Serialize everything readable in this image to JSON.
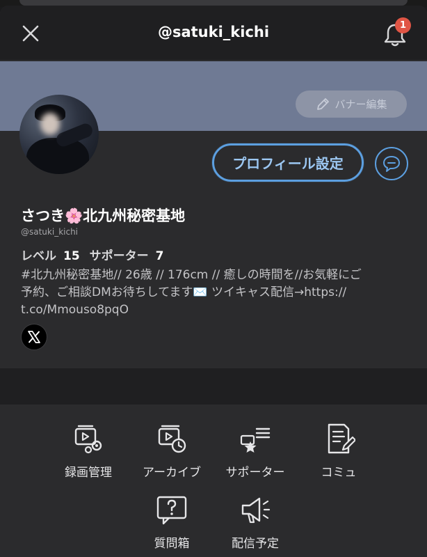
{
  "header": {
    "title": "@satuki_kichi",
    "notification_count": "1",
    "close_icon": "close-icon",
    "bell_icon": "bell-icon"
  },
  "banner": {
    "edit_label": "バナー編集",
    "edit_icon": "pencil-icon"
  },
  "profile": {
    "settings_label": "プロフィール設定",
    "display_name": "さつき🌸北九州秘密基地",
    "handle": "@satuki_kichi",
    "level_label": "レベル",
    "level_value": "15",
    "supporter_label": "サポーター",
    "supporter_value": "7",
    "bio_line1": "#北九州秘密基地// 26歳 // 176cm // 癒しの時間を//お気軽にご",
    "bio_line2": "予約、ご相談DMお待ちしてます✉️ ツイキャス配信→https://",
    "bio_line3": "t.co/Mmouso8pqO",
    "social_icon": "x-logo-icon"
  },
  "menu": {
    "items": [
      {
        "label": "録画管理",
        "icon": "video-settings-icon"
      },
      {
        "label": "アーカイブ",
        "icon": "video-history-icon"
      },
      {
        "label": "サポーター",
        "icon": "supporter-star-icon"
      },
      {
        "label": "コミュ",
        "icon": "community-note-icon"
      },
      {
        "label": "質問箱",
        "icon": "question-box-icon"
      },
      {
        "label": "配信予定",
        "icon": "megaphone-icon"
      }
    ]
  },
  "colors": {
    "background": "#2b2b2d",
    "header": "#1f1f21",
    "banner": "#6f7a94",
    "accent": "#5c9fe0",
    "badge": "#e05545"
  }
}
